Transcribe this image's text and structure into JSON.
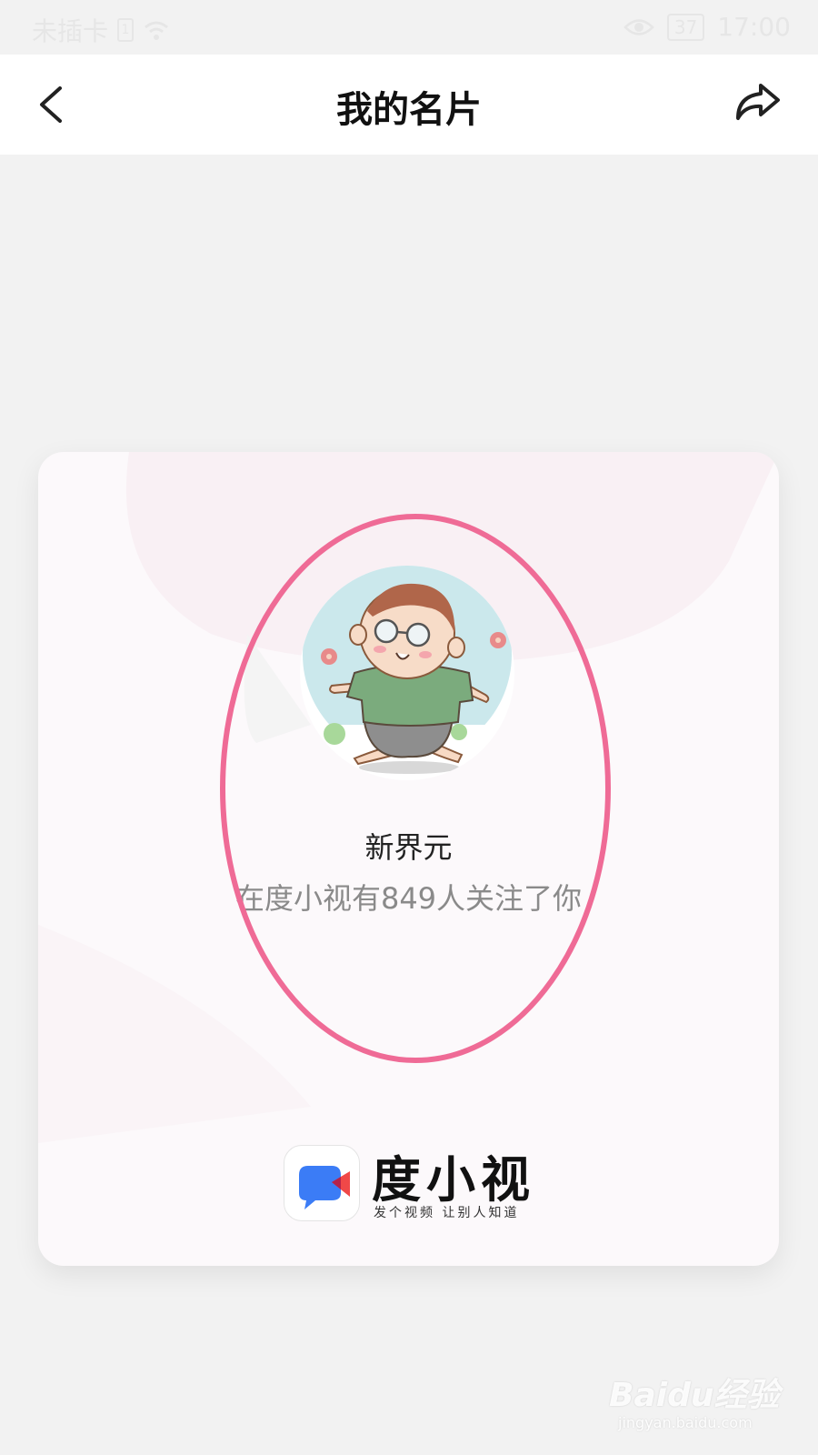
{
  "status_bar": {
    "carrier": "未插卡",
    "sim_indicator": "1",
    "battery": "37",
    "time": "17:00",
    "icons": [
      "wifi-icon",
      "eye-icon",
      "battery-icon"
    ]
  },
  "header": {
    "title": "我的名片",
    "back_icon": "chevron-left-icon",
    "share_icon": "share-arrow-icon"
  },
  "card": {
    "name": "新界元",
    "followers_text": "在度小视有849人关注了你",
    "avatar": "cartoon-baby-avatar"
  },
  "logo": {
    "app_name": "度小视",
    "slogan": "发个视频 让别人知道"
  },
  "watermark": {
    "main": "Baidu经验",
    "sub": "jingyan.baidu.com"
  },
  "colors": {
    "highlight": "#ef6b96",
    "background": "#f2f2f2",
    "logo_blue": "#3b7cf6",
    "logo_red": "#f04848"
  }
}
